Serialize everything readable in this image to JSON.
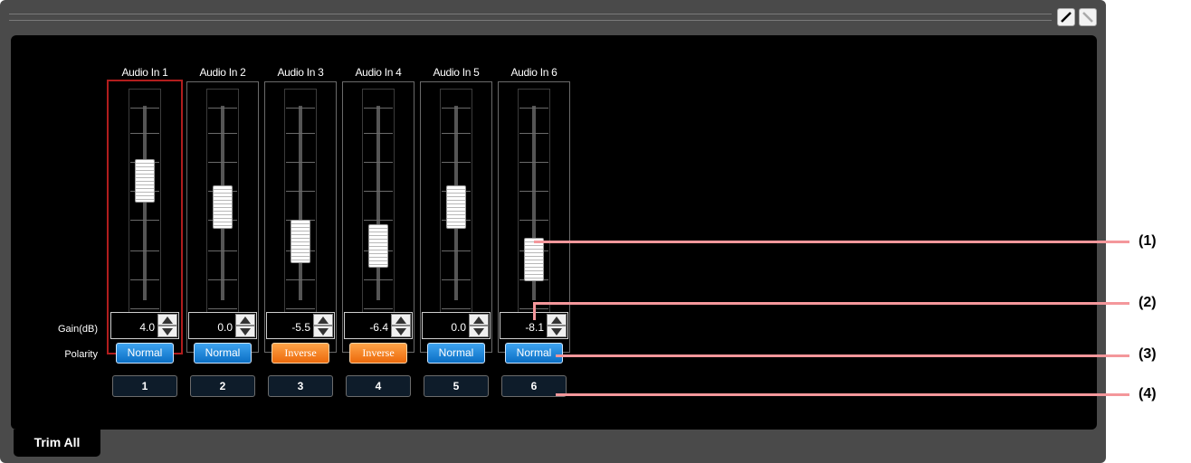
{
  "channels": [
    {
      "title": "Audio In 1",
      "gain": "4.0",
      "polarity": "Normal",
      "number": "1",
      "level": 0.7
    },
    {
      "title": "Audio In 2",
      "gain": "0.0",
      "polarity": "Normal",
      "number": "2",
      "level": 0.55
    },
    {
      "title": "Audio In 3",
      "gain": "-5.5",
      "polarity": "Inverse",
      "number": "3",
      "level": 0.35
    },
    {
      "title": "Audio In 4",
      "gain": "-6.4",
      "polarity": "Inverse",
      "number": "4",
      "level": 0.32
    },
    {
      "title": "Audio In 5",
      "gain": "0.0",
      "polarity": "Normal",
      "number": "5",
      "level": 0.55
    },
    {
      "title": "Audio In 6",
      "gain": "-8.1",
      "polarity": "Normal",
      "number": "6",
      "level": 0.24
    }
  ],
  "labels": {
    "gain": "Gain(dB)",
    "polarity": "Polarity"
  },
  "tab": {
    "label": "Trim All"
  },
  "callouts": [
    "(1)",
    "(2)",
    "(3)",
    "(4)"
  ],
  "colors": {
    "normal": "#1a86dd",
    "inverse": "#f5841f",
    "selected": "#b11d1d",
    "callout": "#f4979b"
  }
}
